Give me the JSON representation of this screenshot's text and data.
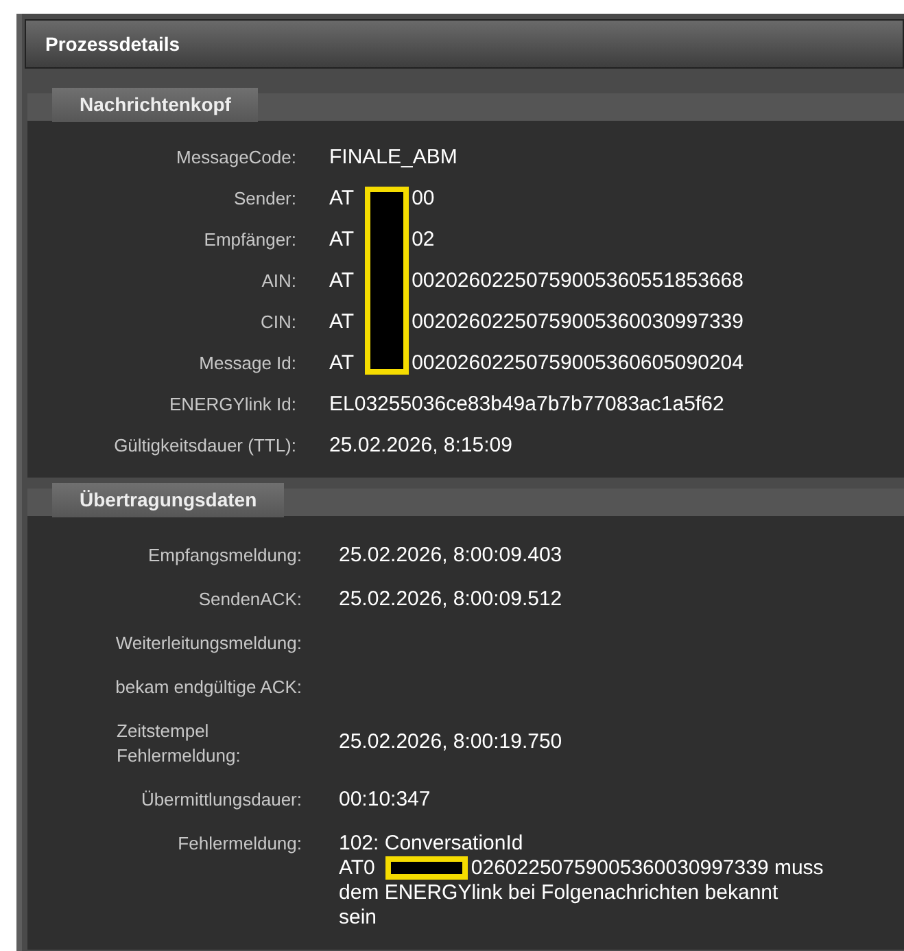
{
  "panel": {
    "title": "Prozessdetails"
  },
  "sections": [
    {
      "title": "Nachrichtenkopf",
      "rows": [
        {
          "label": "MessageCode:",
          "value_parts": [
            "FINALE_ABM"
          ]
        },
        {
          "label": "Sender:",
          "value_parts": [
            "AT",
            "00"
          ]
        },
        {
          "label": "Empfänger:",
          "value_parts": [
            "AT",
            "02"
          ]
        },
        {
          "label": "AIN:",
          "value_parts": [
            "AT",
            "00202602250759005360551853668"
          ]
        },
        {
          "label": "CIN:",
          "value_parts": [
            "AT",
            "00202602250759005360030997339"
          ]
        },
        {
          "label": "Message Id:",
          "value_parts": [
            "AT",
            "00202602250759005360605090204"
          ]
        },
        {
          "label": "ENERGYlink Id:",
          "value_parts": [
            "EL03255036ce83b49a7b7b77083ac1a5f62"
          ]
        },
        {
          "label": "Gültigkeitsdauer (TTL):",
          "value_parts": [
            "25.02.2026, 8:15:09"
          ]
        }
      ]
    },
    {
      "title": "Übertragungsdaten",
      "rows": [
        {
          "label": "Empfangsmeldung:",
          "value_parts": [
            "25.02.2026, 8:00:09.403"
          ]
        },
        {
          "label": "SendenACK:",
          "value_parts": [
            "25.02.2026, 8:00:09.512"
          ]
        },
        {
          "label": "Weiterleitungsmeldung:"
        },
        {
          "label": "bekam endgültige ACK:"
        },
        {
          "label": "Zeitstempel Fehlermeldung:",
          "value_parts": [
            "25.02.2026, 8:00:19.750"
          ]
        },
        {
          "label": "Übermittlungsdauer:",
          "value_parts": [
            "00:10:347"
          ]
        },
        {
          "label": "Fehlermeldung:",
          "value_lines": [
            [
              "102: ConversationId"
            ],
            [
              "AT0",
              "02602250759005360030997339 muss"
            ],
            [
              "dem ENERGYlink bei Folgenachrichten bekannt sein"
            ]
          ]
        }
      ]
    }
  ]
}
